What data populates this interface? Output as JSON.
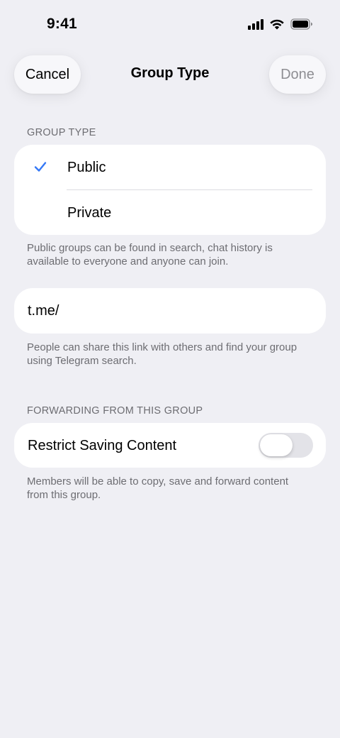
{
  "status_bar": {
    "time": "9:41"
  },
  "nav": {
    "cancel_label": "Cancel",
    "title": "Group Type",
    "done_label": "Done"
  },
  "group_type": {
    "header": "GROUP TYPE",
    "options": [
      {
        "label": "Public",
        "selected": true
      },
      {
        "label": "Private",
        "selected": false
      }
    ],
    "footer": "Public groups can be found in search, chat history is available to everyone and anyone can join."
  },
  "link": {
    "prefix": "t.me/",
    "value": "",
    "footer": "People can share this link with others and find your group using Telegram search."
  },
  "forwarding": {
    "header": "FORWARDING FROM THIS GROUP",
    "toggle_label": "Restrict Saving Content",
    "toggle_on": false,
    "footer": "Members will be able to copy, save and forward content from this group."
  },
  "colors": {
    "accent": "#3478f6",
    "background": "#efeff4",
    "secondary_text": "#6d6d72",
    "toggle_off": "#e3e3e8"
  },
  "icons": [
    "cellular-signal-icon",
    "wifi-icon",
    "battery-icon",
    "checkmark-icon"
  ]
}
